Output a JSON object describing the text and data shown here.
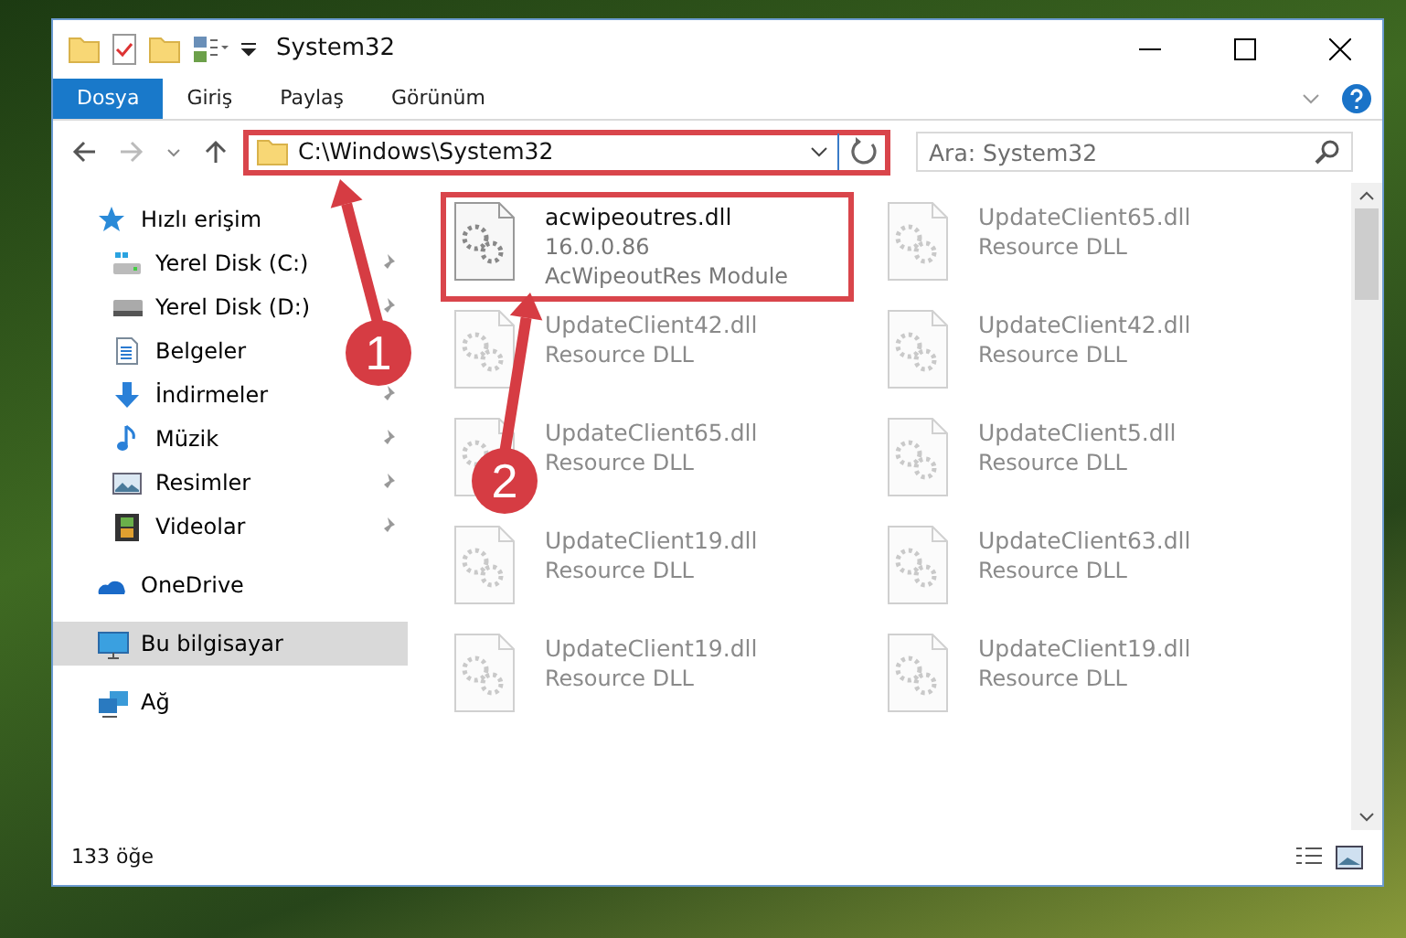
{
  "window": {
    "title": "System32"
  },
  "ribbon_tabs": [
    {
      "label": "Dosya",
      "selected": true
    },
    {
      "label": "Giriş",
      "selected": false
    },
    {
      "label": "Paylaş",
      "selected": false
    },
    {
      "label": "Görünüm",
      "selected": false
    }
  ],
  "address_bar": {
    "path": "C:\\Windows\\System32",
    "highlighted": true
  },
  "search": {
    "placeholder": "Ara: System32"
  },
  "sidebar": {
    "items": [
      {
        "label": "Hızlı erişim",
        "selected": false,
        "children": [
          {
            "label": "Yerel Disk (C:)",
            "pinned": true
          },
          {
            "label": "Yerel Disk (D:)",
            "pinned": true
          },
          {
            "label": "Belgeler"
          },
          {
            "label": "İndirmeler",
            "pinned": true
          },
          {
            "label": "Müzik",
            "pinned": true
          },
          {
            "label": "Resimler",
            "pinned": true
          },
          {
            "label": "Videolar",
            "pinned": true
          }
        ]
      },
      {
        "label": "OneDrive",
        "selected": false
      },
      {
        "label": "Bu bilgisayar",
        "selected": true
      },
      {
        "label": "Ağ",
        "selected": false
      }
    ]
  },
  "files": [
    {
      "name": "acwipeoutres.dll",
      "version": "16.0.0.86",
      "description": "AcWipeoutRes Module",
      "highlighted": true,
      "blurred": false
    },
    {
      "name": "UpdateClient65.dll",
      "description": "Resource DLL",
      "highlighted": false,
      "blurred": true
    },
    {
      "name": "UpdateClient42.dll",
      "description": "Resource DLL",
      "highlighted": false,
      "blurred": true
    },
    {
      "name": "UpdateClient42.dll",
      "description": "Resource DLL",
      "highlighted": false,
      "blurred": true
    },
    {
      "name": "UpdateClient65.dll",
      "description": "Resource DLL",
      "highlighted": false,
      "blurred": true
    },
    {
      "name": "UpdateClient5.dll",
      "description": "Resource DLL",
      "highlighted": false,
      "blurred": true
    },
    {
      "name": "UpdateClient19.dll",
      "description": "Resource DLL",
      "highlighted": false,
      "blurred": true
    },
    {
      "name": "UpdateClient63.dll",
      "description": "Resource DLL",
      "highlighted": false,
      "blurred": true
    },
    {
      "name": "UpdateClient19.dll",
      "description": "Resource DLL",
      "highlighted": false,
      "blurred": true
    },
    {
      "name": "UpdateClient19.dll",
      "description": "Resource DLL",
      "highlighted": false,
      "blurred": true
    }
  ],
  "status_bar": {
    "item_count": "133 öğe"
  },
  "annotations": [
    {
      "number": "1"
    },
    {
      "number": "2"
    }
  ]
}
